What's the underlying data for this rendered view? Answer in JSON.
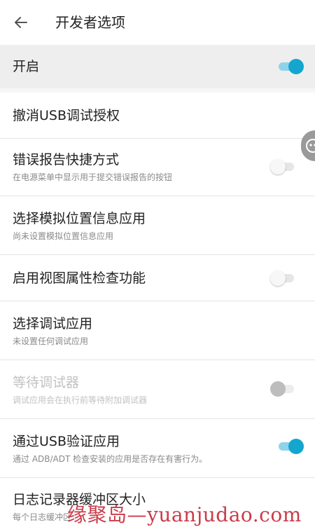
{
  "header": {
    "title": "开发者选项"
  },
  "master_switch": {
    "label": "开启",
    "enabled": true
  },
  "items": [
    {
      "title": "撤消USB调试授权"
    },
    {
      "title": "错误报告快捷方式",
      "subtitle": "在电源菜单中显示用于提交错误报告的按钮",
      "toggle": "off"
    },
    {
      "title": "选择模拟位置信息应用",
      "subtitle": "尚未设置模拟位置信息应用"
    },
    {
      "title": "启用视图属性检查功能",
      "toggle": "off"
    },
    {
      "title": "选择调试应用",
      "subtitle": "未设置任何调试应用"
    },
    {
      "title": "等待调试器",
      "subtitle": "调试应用会在执行前等待附加调试器",
      "toggle": "off",
      "disabled": true
    },
    {
      "title": "通过USB验证应用",
      "subtitle": "通过 ADB/ADT 检查安装的应用是否存在有害行为。",
      "toggle": "on"
    },
    {
      "title": "日志记录器缓冲区大小",
      "subtitle": "每个日志缓冲区"
    }
  ],
  "watermark": "缘聚岛—yuanjudao.com",
  "colors": {
    "accent": "#14a6cf",
    "accent_track": "#8fd3ea",
    "watermark": "#c31a2a"
  }
}
